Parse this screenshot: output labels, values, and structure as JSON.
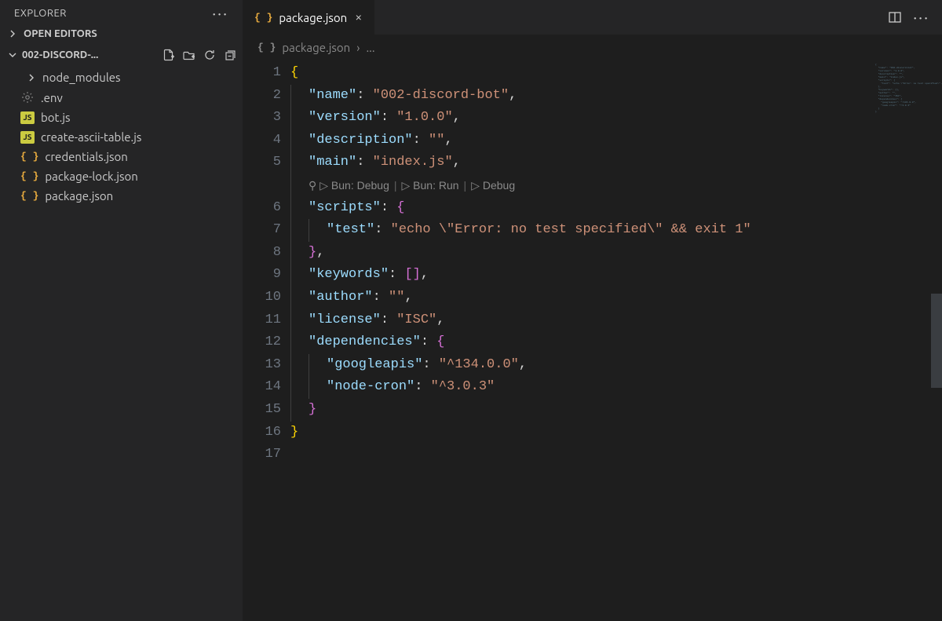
{
  "sidebar": {
    "title": "EXPLORER",
    "open_editors_label": "OPEN EDITORS",
    "folder_name": "002-DISCORD-...",
    "items": [
      {
        "kind": "folder",
        "label": "node_modules"
      },
      {
        "kind": "env",
        "label": ".env"
      },
      {
        "kind": "js",
        "label": "bot.js"
      },
      {
        "kind": "js",
        "label": "create-ascii-table.js"
      },
      {
        "kind": "json",
        "label": "credentials.json"
      },
      {
        "kind": "json",
        "label": "package-lock.json"
      },
      {
        "kind": "json",
        "label": "package.json"
      }
    ]
  },
  "tab": {
    "label": "package.json"
  },
  "breadcrumb": {
    "file": "package.json",
    "rest": "..."
  },
  "codelens": {
    "a": "Bun: Debug",
    "b": "Bun: Run",
    "c": "Debug"
  },
  "code": {
    "line_count": 17,
    "raw": "{\n  \"name\": \"002-discord-bot\",\n  \"version\": \"1.0.0\",\n  \"description\": \"\",\n  \"main\": \"index.js\",\n  \"scripts\": {\n    \"test\": \"echo \\\"Error: no test specified\\\" && exit 1\"\n  },\n  \"keywords\": [],\n  \"author\": \"\",\n  \"license\": \"ISC\",\n  \"dependencies\": {\n    \"googleapis\": \"^134.0.0\",\n    \"node-cron\": \"^3.0.3\"\n  }\n}\n",
    "tokens": [
      [
        {
          "t": "{",
          "c": "brace"
        }
      ],
      [
        {
          "t": "  ",
          "c": "ind"
        },
        {
          "t": "\"name\"",
          "c": "key"
        },
        {
          "t": ": ",
          "c": "punc"
        },
        {
          "t": "\"002-discord-bot\"",
          "c": "str"
        },
        {
          "t": ",",
          "c": "punc"
        }
      ],
      [
        {
          "t": "  ",
          "c": "ind"
        },
        {
          "t": "\"version\"",
          "c": "key"
        },
        {
          "t": ": ",
          "c": "punc"
        },
        {
          "t": "\"1.0.0\"",
          "c": "str"
        },
        {
          "t": ",",
          "c": "punc"
        }
      ],
      [
        {
          "t": "  ",
          "c": "ind"
        },
        {
          "t": "\"description\"",
          "c": "key"
        },
        {
          "t": ": ",
          "c": "punc"
        },
        {
          "t": "\"\"",
          "c": "str"
        },
        {
          "t": ",",
          "c": "punc"
        }
      ],
      [
        {
          "t": "  ",
          "c": "ind"
        },
        {
          "t": "\"main\"",
          "c": "key"
        },
        {
          "t": ": ",
          "c": "punc"
        },
        {
          "t": "\"index.js\"",
          "c": "str"
        },
        {
          "t": ",",
          "c": "punc"
        }
      ],
      [
        {
          "t": "  ",
          "c": "ind"
        },
        {
          "t": "\"scripts\"",
          "c": "key"
        },
        {
          "t": ": ",
          "c": "punc"
        },
        {
          "t": "{",
          "c": "brace-p"
        }
      ],
      [
        {
          "t": "    ",
          "c": "ind2"
        },
        {
          "t": "\"test\"",
          "c": "key"
        },
        {
          "t": ": ",
          "c": "punc"
        },
        {
          "t": "\"echo \\\"Error: no test specified\\\" && exit 1\"",
          "c": "str"
        }
      ],
      [
        {
          "t": "  ",
          "c": "ind"
        },
        {
          "t": "}",
          "c": "brace-p"
        },
        {
          "t": ",",
          "c": "punc"
        }
      ],
      [
        {
          "t": "  ",
          "c": "ind"
        },
        {
          "t": "\"keywords\"",
          "c": "key"
        },
        {
          "t": ": ",
          "c": "punc"
        },
        {
          "t": "[",
          "c": "brace-p"
        },
        {
          "t": "]",
          "c": "brace-p"
        },
        {
          "t": ",",
          "c": "punc"
        }
      ],
      [
        {
          "t": "  ",
          "c": "ind"
        },
        {
          "t": "\"author\"",
          "c": "key"
        },
        {
          "t": ": ",
          "c": "punc"
        },
        {
          "t": "\"\"",
          "c": "str"
        },
        {
          "t": ",",
          "c": "punc"
        }
      ],
      [
        {
          "t": "  ",
          "c": "ind"
        },
        {
          "t": "\"license\"",
          "c": "key"
        },
        {
          "t": ": ",
          "c": "punc"
        },
        {
          "t": "\"ISC\"",
          "c": "str"
        },
        {
          "t": ",",
          "c": "punc"
        }
      ],
      [
        {
          "t": "  ",
          "c": "ind"
        },
        {
          "t": "\"dependencies\"",
          "c": "key"
        },
        {
          "t": ": ",
          "c": "punc"
        },
        {
          "t": "{",
          "c": "brace-p"
        }
      ],
      [
        {
          "t": "    ",
          "c": "ind2"
        },
        {
          "t": "\"googleapis\"",
          "c": "key"
        },
        {
          "t": ": ",
          "c": "punc"
        },
        {
          "t": "\"^134.0.0\"",
          "c": "str"
        },
        {
          "t": ",",
          "c": "punc"
        }
      ],
      [
        {
          "t": "    ",
          "c": "ind2"
        },
        {
          "t": "\"node-cron\"",
          "c": "key"
        },
        {
          "t": ": ",
          "c": "punc"
        },
        {
          "t": "\"^3.0.3\"",
          "c": "str"
        }
      ],
      [
        {
          "t": "  ",
          "c": "ind"
        },
        {
          "t": "}",
          "c": "brace-p"
        }
      ],
      [
        {
          "t": "}",
          "c": "brace"
        }
      ],
      []
    ]
  }
}
